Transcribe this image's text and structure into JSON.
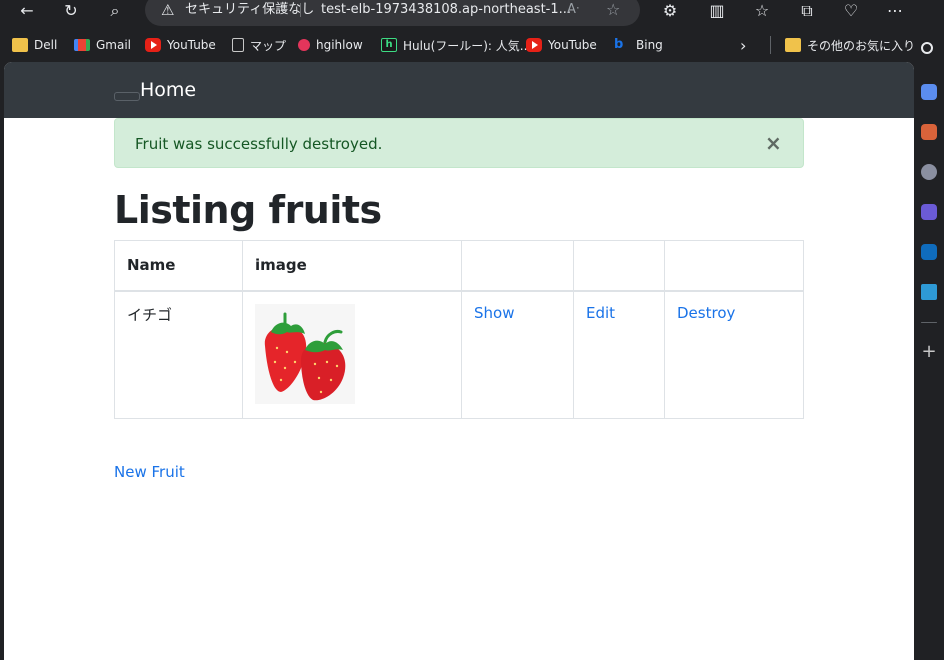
{
  "browser": {
    "address": {
      "security_label": "セキュリティ保護なし",
      "url": "test-elb-1973438108.ap-northeast-1...",
      "read_aloud": "Á"
    },
    "bookmarks": [
      {
        "label": "Dell",
        "icon": "folder-icon"
      },
      {
        "label": "Gmail",
        "icon": "gmail-icon"
      },
      {
        "label": "YouTube",
        "icon": "youtube-icon"
      },
      {
        "label": "マップ",
        "icon": "document-icon"
      },
      {
        "label": "hgihlow",
        "icon": "hgihlow-icon"
      },
      {
        "label": "Hulu(フールー): 人気...",
        "icon": "hulu-icon"
      },
      {
        "label": "YouTube",
        "icon": "youtube-icon"
      },
      {
        "label": "Bing",
        "icon": "bing-icon"
      }
    ],
    "other_favorites": "その他のお気に入り"
  },
  "page": {
    "navbar": {
      "brand": "Home"
    },
    "notice": {
      "message": "Fruit was successfully destroyed.",
      "close": "×"
    },
    "title": "Listing fruits",
    "table": {
      "headers": [
        "Name",
        "image",
        "",
        "",
        ""
      ],
      "rows": [
        {
          "name": "イチゴ",
          "image_alt": "strawberries",
          "show": "Show",
          "edit": "Edit",
          "destroy": "Destroy"
        }
      ]
    },
    "new_link": "New Fruit"
  },
  "colors": {
    "navbar_bg": "#343a40",
    "alert_bg": "#d4edda",
    "alert_text": "#155724",
    "link": "#1a73e8",
    "strawberry_red": "#e5252a",
    "leaf_green": "#2e9e3a"
  }
}
